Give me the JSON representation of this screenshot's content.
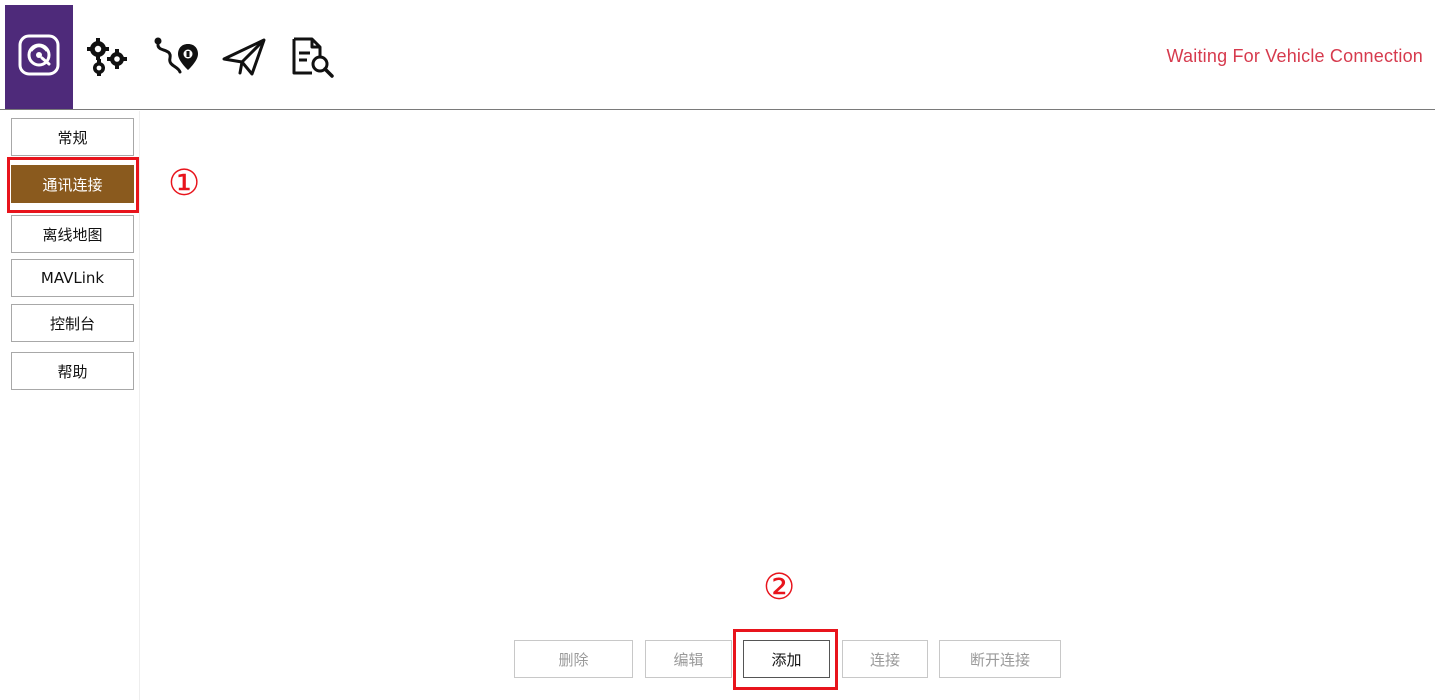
{
  "toolbar": {
    "icons": [
      "app-logo-icon",
      "settings-gears-icon",
      "route-plan-icon",
      "fly-send-icon",
      "log-analyze-icon"
    ],
    "status_text": "Waiting For Vehicle Connection",
    "status_color": "#d63a4d",
    "brand_color": "#4e2a7a"
  },
  "sidebar": {
    "items": [
      {
        "label": "常规"
      },
      {
        "label": "通讯连接",
        "active": true
      },
      {
        "label": "离线地图"
      },
      {
        "label": "MAVLink"
      },
      {
        "label": "控制台"
      },
      {
        "label": "帮助"
      }
    ],
    "active_color": "#8a5a1e"
  },
  "actions": {
    "delete": "删除",
    "edit": "编辑",
    "add": "添加",
    "connect": "连接",
    "disconnect": "断开连接"
  },
  "annotations": {
    "step1": "①",
    "step2": "②",
    "highlight_color": "#e8141c"
  }
}
